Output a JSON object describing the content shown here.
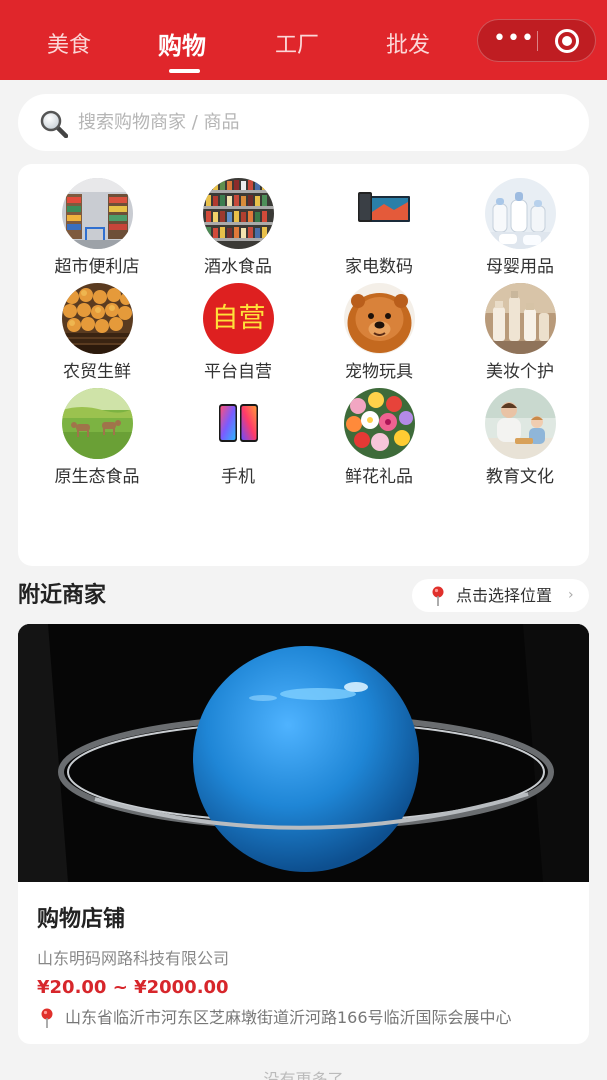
{
  "header": {
    "tabs": [
      {
        "label": "美食",
        "active": false
      },
      {
        "label": "购物",
        "active": true
      },
      {
        "label": "工厂",
        "active": false
      },
      {
        "label": "批发",
        "active": false
      }
    ],
    "menu_icon": "more-dots-icon",
    "close_icon": "target-icon",
    "accent_color": "#e0262b"
  },
  "search": {
    "placeholder": "搜索购物商家 / 商品",
    "icon": "search-icon"
  },
  "categories": [
    {
      "label": "超市便利店",
      "icon": "supermarket-photo"
    },
    {
      "label": "酒水食品",
      "icon": "drinks-shelf-photo"
    },
    {
      "label": "家电数码",
      "icon": "tv-phone-photo"
    },
    {
      "label": "母婴用品",
      "icon": "baby-bottles-photo"
    },
    {
      "label": "农贸生鲜",
      "icon": "fruit-crate-photo"
    },
    {
      "label": "平台自营",
      "icon": "self-operated-badge",
      "badge_text": "自营"
    },
    {
      "label": "宠物玩具",
      "icon": "chow-dog-photo"
    },
    {
      "label": "美妆个护",
      "icon": "cosmetics-bottles-photo"
    },
    {
      "label": "原生态食品",
      "icon": "pasture-cattle-photo"
    },
    {
      "label": "手机",
      "icon": "smartphones-photo"
    },
    {
      "label": "鲜花礼品",
      "icon": "flower-bouquet-photo"
    },
    {
      "label": "教育文化",
      "icon": "parent-child-photo"
    }
  ],
  "nearby": {
    "title": "附近商家",
    "location_button": "点击选择位置",
    "location_icon": "map-pin-icon"
  },
  "store": {
    "banner": "planet-neptune-ring-image",
    "name": "购物店铺",
    "company": "山东明码网路科技有限公司",
    "price_range": "¥20.00 ~ ¥2000.00",
    "address": "山东省临沂市河东区芝麻墩街道沂河路166号临沂国际会展中心",
    "price_color": "#d7262b"
  },
  "footer_hint": "没有更多了"
}
